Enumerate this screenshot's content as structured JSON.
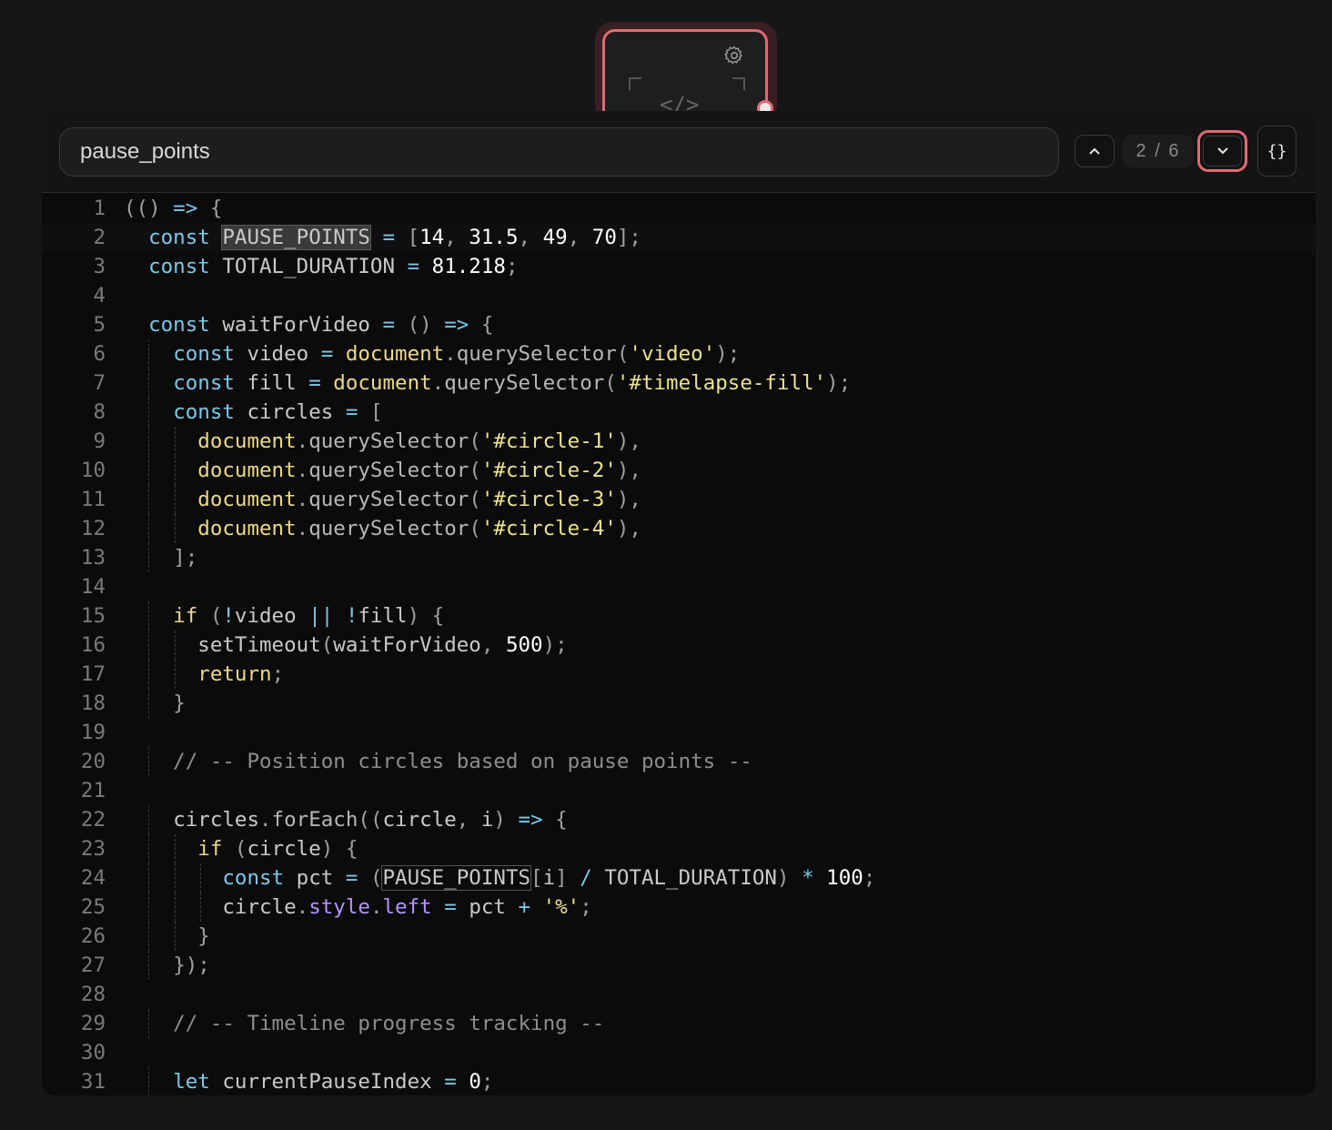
{
  "search": {
    "value": "pause_points",
    "counter": "2 / 6",
    "format_label": "{}"
  },
  "node": {
    "code_glyph": "</>"
  },
  "colors": {
    "accent": "#e06a72",
    "background": "#0b0b0c"
  },
  "code_lines": [
    "(() => {",
    "  const PAUSE_POINTS = [14, 31.5, 49, 70];",
    "  const TOTAL_DURATION = 81.218;",
    "",
    "  const waitForVideo = () => {",
    "    const video = document.querySelector('video');",
    "    const fill = document.querySelector('#timelapse-fill');",
    "    const circles = [",
    "      document.querySelector('#circle-1'),",
    "      document.querySelector('#circle-2'),",
    "      document.querySelector('#circle-3'),",
    "      document.querySelector('#circle-4'),",
    "    ];",
    "",
    "    if (!video || !fill) {",
    "      setTimeout(waitForVideo, 500);",
    "      return;",
    "    }",
    "",
    "    // -- Position circles based on pause points --",
    "",
    "    circles.forEach((circle, i) => {",
    "      if (circle) {",
    "        const pct = (PAUSE_POINTS[i] / TOTAL_DURATION) * 100;",
    "        circle.style.left = pct + '%';",
    "      }",
    "    });",
    "",
    "    // -- Timeline progress tracking --",
    "",
    "    let currentPauseIndex = 0;"
  ]
}
